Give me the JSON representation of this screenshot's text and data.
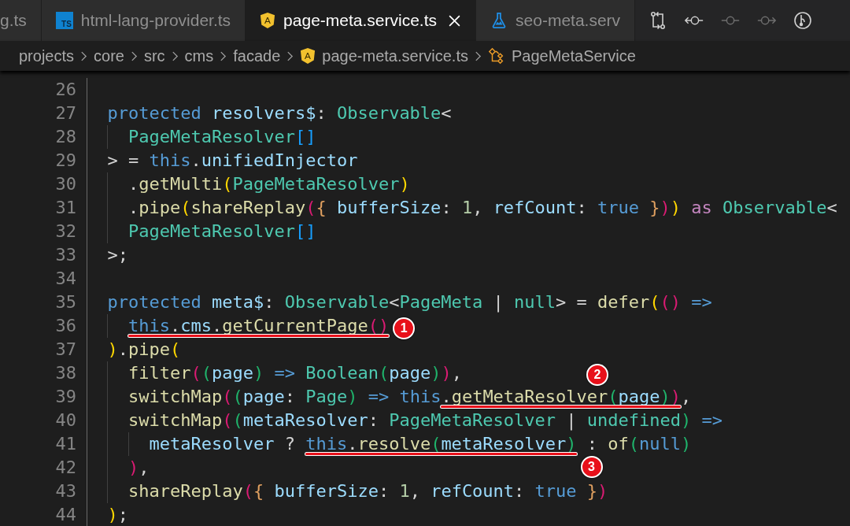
{
  "tabs": [
    {
      "label": "g.ts",
      "selected": false
    },
    {
      "label": "html-lang-provider.ts",
      "kind": "typescript",
      "icon_label": "TS",
      "selected": false
    },
    {
      "label": "page-meta.service.ts",
      "kind": "angular",
      "icon_label": "A",
      "selected": true
    },
    {
      "label": "seo-meta.serv",
      "kind": "test",
      "selected": false
    }
  ],
  "toolbar": [
    {
      "disabled": false
    },
    {
      "disabled": false
    },
    {
      "disabled": true
    },
    {
      "disabled": true
    },
    {
      "disabled": false
    }
  ],
  "breadcrumbs": [
    {
      "label": "projects"
    },
    {
      "label": "core"
    },
    {
      "label": "src"
    },
    {
      "label": "cms"
    },
    {
      "label": "facade"
    },
    {
      "label": "page-meta.service.ts",
      "kind": "angular",
      "icon_label": "A"
    },
    {
      "label": "PageMetaService",
      "kind": "class"
    }
  ],
  "lines": [
    {
      "number": "26"
    },
    {
      "number": "27",
      "tokens": [
        {
          "text": "  protected",
          "kind": "kw"
        },
        {
          "text": " resolvers$",
          "kind": "var"
        },
        {
          "text": ": ",
          "kind": "p"
        },
        {
          "text": "Observable",
          "kind": "type"
        },
        {
          "text": "<",
          "kind": "p"
        }
      ]
    },
    {
      "number": "28",
      "tokens": [
        {
          "text": "    PageMetaResolver",
          "kind": "type"
        },
        {
          "text": "[]",
          "kind": "b5"
        }
      ]
    },
    {
      "number": "29",
      "tokens": [
        {
          "text": "  > = ",
          "kind": "p"
        },
        {
          "text": "this",
          "kind": "kw"
        },
        {
          "text": ".",
          "kind": "p"
        },
        {
          "text": "unifiedInjector",
          "kind": "var"
        }
      ]
    },
    {
      "number": "30",
      "tokens": [
        {
          "text": "    .",
          "kind": "p"
        },
        {
          "text": "getMulti",
          "kind": "fn"
        },
        {
          "text": "(",
          "kind": "b1"
        },
        {
          "text": "PageMetaResolver",
          "kind": "type"
        },
        {
          "text": ")",
          "kind": "b1"
        }
      ]
    },
    {
      "number": "31",
      "tokens": [
        {
          "text": "    .",
          "kind": "p"
        },
        {
          "text": "pipe",
          "kind": "fn"
        },
        {
          "text": "(",
          "kind": "b1"
        },
        {
          "text": "shareReplay",
          "kind": "fn"
        },
        {
          "text": "(",
          "kind": "b2"
        },
        {
          "text": "{",
          "kind": "b4"
        },
        {
          "text": " bufferSize",
          "kind": "var"
        },
        {
          "text": ": ",
          "kind": "p"
        },
        {
          "text": "1",
          "kind": "num"
        },
        {
          "text": ", ",
          "kind": "p"
        },
        {
          "text": "refCount",
          "kind": "var"
        },
        {
          "text": ": ",
          "kind": "p"
        },
        {
          "text": "true ",
          "kind": "kw"
        },
        {
          "text": "}",
          "kind": "b4"
        },
        {
          "text": ")",
          "kind": "b2"
        },
        {
          "text": ")",
          "kind": "b1"
        },
        {
          "text": " as ",
          "kind": "ctl"
        },
        {
          "text": "Observable",
          "kind": "type"
        },
        {
          "text": "<",
          "kind": "p"
        }
      ]
    },
    {
      "number": "32",
      "tokens": [
        {
          "text": "    PageMetaResolver",
          "kind": "type"
        },
        {
          "text": "[]",
          "kind": "b5"
        }
      ]
    },
    {
      "number": "33",
      "tokens": [
        {
          "text": "  >;",
          "kind": "p"
        }
      ]
    },
    {
      "number": "34"
    },
    {
      "number": "35",
      "tokens": [
        {
          "text": "  protected",
          "kind": "kw"
        },
        {
          "text": " meta$",
          "kind": "var"
        },
        {
          "text": ": ",
          "kind": "p"
        },
        {
          "text": "Observable",
          "kind": "type"
        },
        {
          "text": "<",
          "kind": "p"
        },
        {
          "text": "PageMeta",
          "kind": "type"
        },
        {
          "text": " | ",
          "kind": "p"
        },
        {
          "text": "null",
          "kind": "type"
        },
        {
          "text": "> = ",
          "kind": "p"
        },
        {
          "text": "defer",
          "kind": "fn"
        },
        {
          "text": "(",
          "kind": "b1"
        },
        {
          "text": "()",
          "kind": "b2"
        },
        {
          "text": " =>",
          "kind": "kw"
        }
      ]
    },
    {
      "number": "36",
      "tokens": [
        {
          "kind": "mark",
          "callout": {
            "number": "1",
            "kind": "after"
          },
          "tokens": [
            {
              "text": "    this",
              "kind": "kw"
            },
            {
              "text": ".",
              "kind": "p"
            },
            {
              "text": "cms",
              "kind": "var"
            },
            {
              "text": ".",
              "kind": "p"
            },
            {
              "text": "getCurrentPage",
              "kind": "fn"
            },
            {
              "text": "()",
              "kind": "b2"
            }
          ]
        }
      ]
    },
    {
      "number": "37",
      "tokens": [
        {
          "text": "  )",
          "kind": "b1"
        },
        {
          "text": ".",
          "kind": "p"
        },
        {
          "text": "pipe",
          "kind": "fn"
        },
        {
          "text": "(",
          "kind": "b1"
        }
      ]
    },
    {
      "number": "38",
      "tokens": [
        {
          "text": "    filter",
          "kind": "fn"
        },
        {
          "text": "(",
          "kind": "b2"
        },
        {
          "text": "(",
          "kind": "b3"
        },
        {
          "text": "page",
          "kind": "var"
        },
        {
          "text": ")",
          "kind": "b3"
        },
        {
          "text": " => ",
          "kind": "kw"
        },
        {
          "text": "Boolean",
          "kind": "type"
        },
        {
          "text": "(",
          "kind": "b3"
        },
        {
          "text": "page",
          "kind": "var"
        },
        {
          "text": ")",
          "kind": "b3"
        },
        {
          "text": ")",
          "kind": "b2"
        },
        {
          "text": ",",
          "kind": "p"
        }
      ]
    },
    {
      "number": "39",
      "tokens": [
        {
          "text": "    switchMap",
          "kind": "fn"
        },
        {
          "text": "(",
          "kind": "b2"
        },
        {
          "text": "(",
          "kind": "b3"
        },
        {
          "text": "page",
          "kind": "var"
        },
        {
          "text": ": ",
          "kind": "p"
        },
        {
          "text": "Page",
          "kind": "type"
        },
        {
          "text": ")",
          "kind": "b3"
        },
        {
          "text": " => ",
          "kind": "kw"
        },
        {
          "text": "this",
          "kind": "kw"
        },
        {
          "kind": "mark",
          "callout": {
            "number": "2",
            "kind": "above"
          },
          "tokens": [
            {
              "text": ".",
              "kind": "p"
            },
            {
              "text": "getMetaResolver",
              "kind": "fn"
            },
            {
              "text": "(",
              "kind": "b3"
            },
            {
              "text": "page",
              "kind": "var"
            },
            {
              "text": ")",
              "kind": "b3"
            },
            {
              "text": ")",
              "kind": "b2"
            }
          ]
        },
        {
          "text": ",",
          "kind": "p"
        }
      ]
    },
    {
      "number": "40",
      "tokens": [
        {
          "text": "    switchMap",
          "kind": "fn"
        },
        {
          "text": "(",
          "kind": "b2"
        },
        {
          "text": "(",
          "kind": "b3"
        },
        {
          "text": "metaResolver",
          "kind": "var"
        },
        {
          "text": ": ",
          "kind": "p"
        },
        {
          "text": "PageMetaResolver",
          "kind": "type"
        },
        {
          "text": " | ",
          "kind": "p"
        },
        {
          "text": "undefined",
          "kind": "type"
        },
        {
          "text": ")",
          "kind": "b3"
        },
        {
          "text": " =>",
          "kind": "kw"
        }
      ]
    },
    {
      "number": "41",
      "tokens": [
        {
          "text": "      metaResolver",
          "kind": "var"
        },
        {
          "text": " ? ",
          "kind": "p"
        },
        {
          "kind": "mark",
          "callout": {
            "number": "3",
            "kind": "below"
          },
          "tokens": [
            {
              "text": "this",
              "kind": "kw"
            },
            {
              "text": ".",
              "kind": "p"
            },
            {
              "text": "resolve",
              "kind": "fn"
            },
            {
              "text": "(",
              "kind": "b3"
            },
            {
              "text": "metaResolver",
              "kind": "var"
            },
            {
              "text": ")",
              "kind": "b3"
            }
          ]
        },
        {
          "text": " : ",
          "kind": "p"
        },
        {
          "text": "of",
          "kind": "fn"
        },
        {
          "text": "(",
          "kind": "b3"
        },
        {
          "text": "null",
          "kind": "kw"
        },
        {
          "text": ")",
          "kind": "b3"
        }
      ]
    },
    {
      "number": "42",
      "tokens": [
        {
          "text": "    )",
          "kind": "b2"
        },
        {
          "text": ",",
          "kind": "p"
        }
      ]
    },
    {
      "number": "43",
      "tokens": [
        {
          "text": "    shareReplay",
          "kind": "fn"
        },
        {
          "text": "(",
          "kind": "b2"
        },
        {
          "text": "{",
          "kind": "b4"
        },
        {
          "text": " bufferSize",
          "kind": "var"
        },
        {
          "text": ": ",
          "kind": "p"
        },
        {
          "text": "1",
          "kind": "num"
        },
        {
          "text": ", ",
          "kind": "p"
        },
        {
          "text": "refCount",
          "kind": "var"
        },
        {
          "text": ": ",
          "kind": "p"
        },
        {
          "text": "true ",
          "kind": "kw"
        },
        {
          "text": "}",
          "kind": "b4"
        },
        {
          "text": ")",
          "kind": "b2"
        }
      ]
    },
    {
      "number": "44",
      "tokens": [
        {
          "text": "  )",
          "kind": "b1"
        },
        {
          "text": ";",
          "kind": "p"
        }
      ]
    }
  ]
}
